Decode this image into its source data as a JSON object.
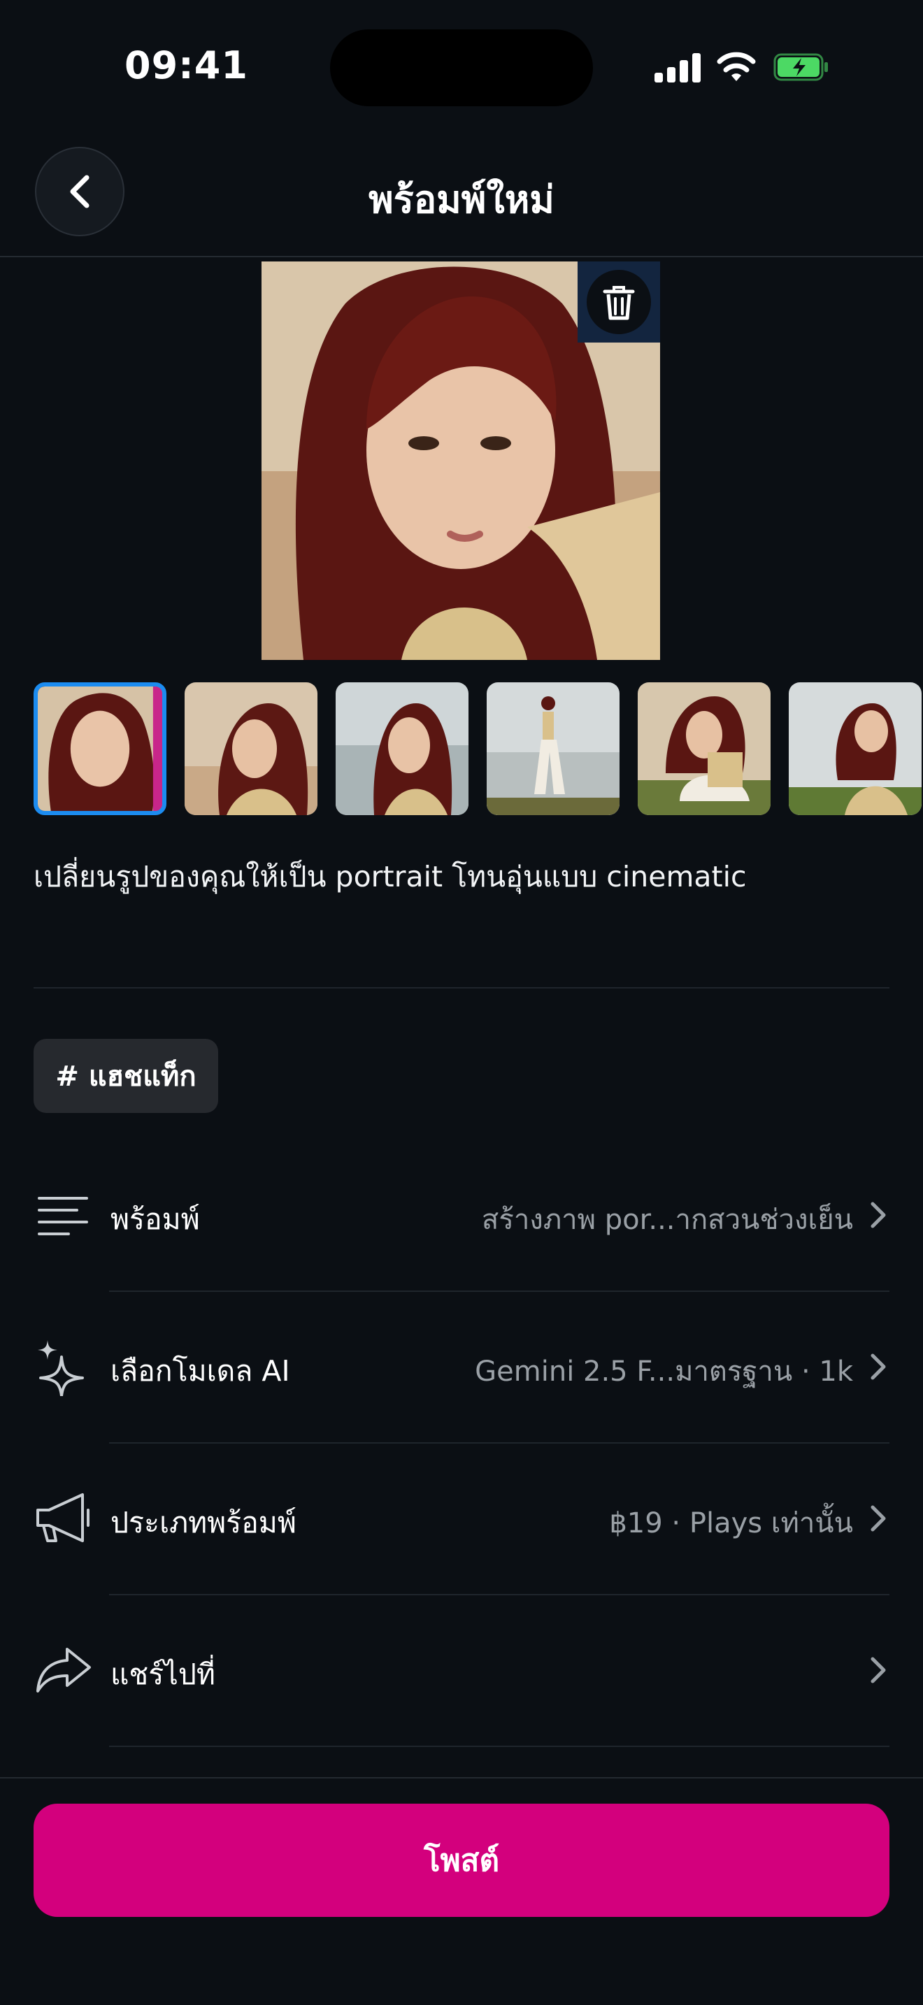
{
  "status": {
    "time": "09:41"
  },
  "header": {
    "title": "พร้อมพ์ใหม่"
  },
  "images": {
    "thumbnail_count": 6,
    "selected_index": 0
  },
  "prompt_text": "เปลี่ยนรูปของคุณให้เป็น portrait โทนอุ่นแบบ cinematic",
  "hashtag": {
    "label": "# แฮชแท็ก"
  },
  "rows": [
    {
      "label": "พร้อมพ์",
      "value": "สร้างภาพ por...ากสวนช่วงเย็น",
      "icon": "lines-icon"
    },
    {
      "label": "เลือกโมเดล AI",
      "value": "Gemini 2.5 F...มาตรฐาน · 1k",
      "icon": "sparkle-icon"
    },
    {
      "label": "ประเภทพร้อมพ์",
      "value": "฿19 · Plays เท่านั้น",
      "icon": "megaphone-icon"
    },
    {
      "label": "แชร์ไปที่",
      "value": "",
      "icon": "share-arrow-icon"
    }
  ],
  "post_button": {
    "label": "โพสต์"
  },
  "colors": {
    "accent": "#d3007d",
    "selection": "#1c8cf0",
    "background": "#0b0f14"
  }
}
